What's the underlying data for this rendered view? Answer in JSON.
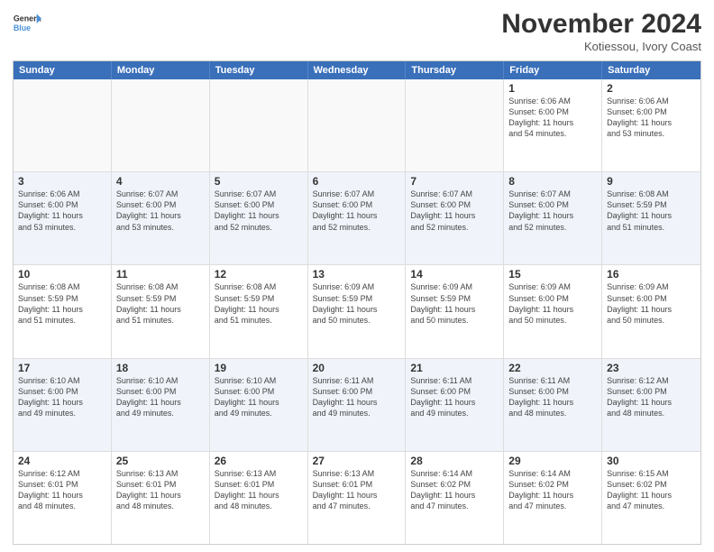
{
  "header": {
    "logo_general": "General",
    "logo_blue": "Blue",
    "month_title": "November 2024",
    "location": "Kotiessou, Ivory Coast"
  },
  "weekdays": [
    "Sunday",
    "Monday",
    "Tuesday",
    "Wednesday",
    "Thursday",
    "Friday",
    "Saturday"
  ],
  "rows": [
    [
      {
        "day": "",
        "info": ""
      },
      {
        "day": "",
        "info": ""
      },
      {
        "day": "",
        "info": ""
      },
      {
        "day": "",
        "info": ""
      },
      {
        "day": "",
        "info": ""
      },
      {
        "day": "1",
        "info": "Sunrise: 6:06 AM\nSunset: 6:00 PM\nDaylight: 11 hours\nand 54 minutes."
      },
      {
        "day": "2",
        "info": "Sunrise: 6:06 AM\nSunset: 6:00 PM\nDaylight: 11 hours\nand 53 minutes."
      }
    ],
    [
      {
        "day": "3",
        "info": "Sunrise: 6:06 AM\nSunset: 6:00 PM\nDaylight: 11 hours\nand 53 minutes."
      },
      {
        "day": "4",
        "info": "Sunrise: 6:07 AM\nSunset: 6:00 PM\nDaylight: 11 hours\nand 53 minutes."
      },
      {
        "day": "5",
        "info": "Sunrise: 6:07 AM\nSunset: 6:00 PM\nDaylight: 11 hours\nand 52 minutes."
      },
      {
        "day": "6",
        "info": "Sunrise: 6:07 AM\nSunset: 6:00 PM\nDaylight: 11 hours\nand 52 minutes."
      },
      {
        "day": "7",
        "info": "Sunrise: 6:07 AM\nSunset: 6:00 PM\nDaylight: 11 hours\nand 52 minutes."
      },
      {
        "day": "8",
        "info": "Sunrise: 6:07 AM\nSunset: 6:00 PM\nDaylight: 11 hours\nand 52 minutes."
      },
      {
        "day": "9",
        "info": "Sunrise: 6:08 AM\nSunset: 5:59 PM\nDaylight: 11 hours\nand 51 minutes."
      }
    ],
    [
      {
        "day": "10",
        "info": "Sunrise: 6:08 AM\nSunset: 5:59 PM\nDaylight: 11 hours\nand 51 minutes."
      },
      {
        "day": "11",
        "info": "Sunrise: 6:08 AM\nSunset: 5:59 PM\nDaylight: 11 hours\nand 51 minutes."
      },
      {
        "day": "12",
        "info": "Sunrise: 6:08 AM\nSunset: 5:59 PM\nDaylight: 11 hours\nand 51 minutes."
      },
      {
        "day": "13",
        "info": "Sunrise: 6:09 AM\nSunset: 5:59 PM\nDaylight: 11 hours\nand 50 minutes."
      },
      {
        "day": "14",
        "info": "Sunrise: 6:09 AM\nSunset: 5:59 PM\nDaylight: 11 hours\nand 50 minutes."
      },
      {
        "day": "15",
        "info": "Sunrise: 6:09 AM\nSunset: 6:00 PM\nDaylight: 11 hours\nand 50 minutes."
      },
      {
        "day": "16",
        "info": "Sunrise: 6:09 AM\nSunset: 6:00 PM\nDaylight: 11 hours\nand 50 minutes."
      }
    ],
    [
      {
        "day": "17",
        "info": "Sunrise: 6:10 AM\nSunset: 6:00 PM\nDaylight: 11 hours\nand 49 minutes."
      },
      {
        "day": "18",
        "info": "Sunrise: 6:10 AM\nSunset: 6:00 PM\nDaylight: 11 hours\nand 49 minutes."
      },
      {
        "day": "19",
        "info": "Sunrise: 6:10 AM\nSunset: 6:00 PM\nDaylight: 11 hours\nand 49 minutes."
      },
      {
        "day": "20",
        "info": "Sunrise: 6:11 AM\nSunset: 6:00 PM\nDaylight: 11 hours\nand 49 minutes."
      },
      {
        "day": "21",
        "info": "Sunrise: 6:11 AM\nSunset: 6:00 PM\nDaylight: 11 hours\nand 49 minutes."
      },
      {
        "day": "22",
        "info": "Sunrise: 6:11 AM\nSunset: 6:00 PM\nDaylight: 11 hours\nand 48 minutes."
      },
      {
        "day": "23",
        "info": "Sunrise: 6:12 AM\nSunset: 6:00 PM\nDaylight: 11 hours\nand 48 minutes."
      }
    ],
    [
      {
        "day": "24",
        "info": "Sunrise: 6:12 AM\nSunset: 6:01 PM\nDaylight: 11 hours\nand 48 minutes."
      },
      {
        "day": "25",
        "info": "Sunrise: 6:13 AM\nSunset: 6:01 PM\nDaylight: 11 hours\nand 48 minutes."
      },
      {
        "day": "26",
        "info": "Sunrise: 6:13 AM\nSunset: 6:01 PM\nDaylight: 11 hours\nand 48 minutes."
      },
      {
        "day": "27",
        "info": "Sunrise: 6:13 AM\nSunset: 6:01 PM\nDaylight: 11 hours\nand 47 minutes."
      },
      {
        "day": "28",
        "info": "Sunrise: 6:14 AM\nSunset: 6:02 PM\nDaylight: 11 hours\nand 47 minutes."
      },
      {
        "day": "29",
        "info": "Sunrise: 6:14 AM\nSunset: 6:02 PM\nDaylight: 11 hours\nand 47 minutes."
      },
      {
        "day": "30",
        "info": "Sunrise: 6:15 AM\nSunset: 6:02 PM\nDaylight: 11 hours\nand 47 minutes."
      }
    ]
  ]
}
